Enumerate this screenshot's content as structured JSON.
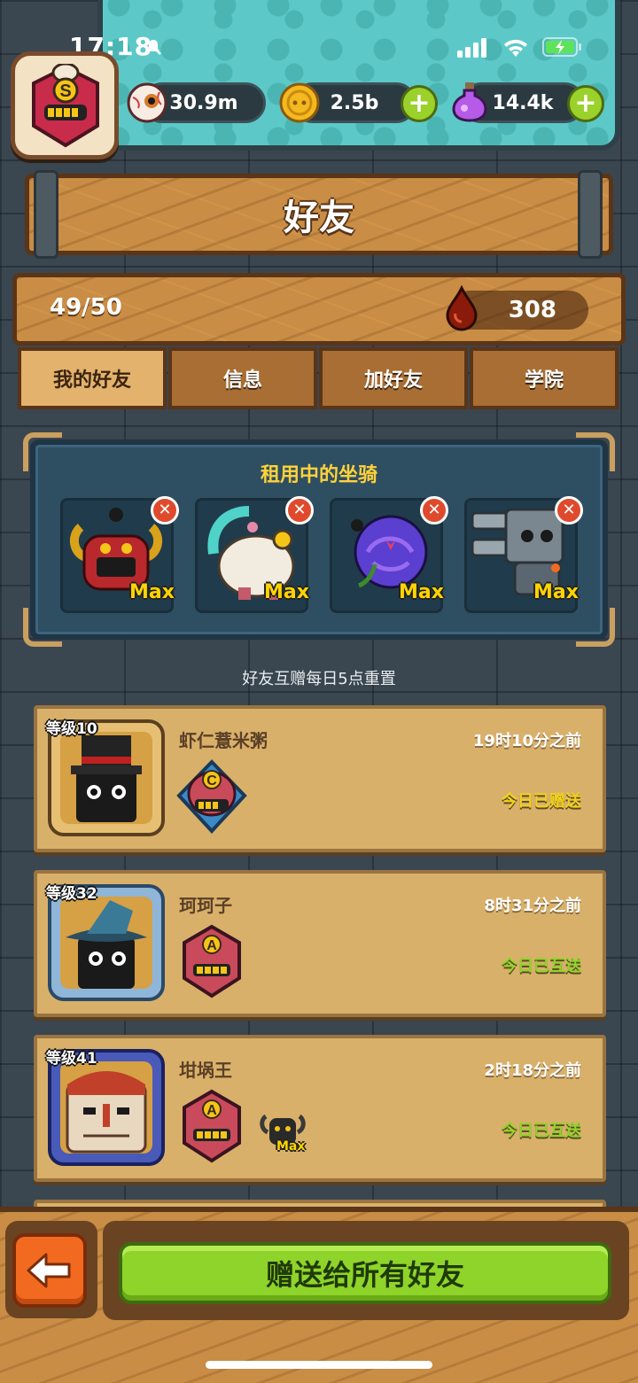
{
  "status_bar": {
    "time": "17:18"
  },
  "header": {
    "rank_letter": "S",
    "resources": {
      "eyes": "30.9m",
      "coins": "2.5b",
      "potions": "14.4k"
    }
  },
  "title": "好友",
  "friend_count": "49/50",
  "blood": "308",
  "tabs": [
    {
      "label": "我的好友",
      "active": true
    },
    {
      "label": "信息"
    },
    {
      "label": "加好友"
    },
    {
      "label": "学院"
    }
  ],
  "mounts": {
    "title": "租用中的坐骑",
    "max_label": "Max",
    "items": [
      {
        "name": "red-demon-mount"
      },
      {
        "name": "white-beast-mount"
      },
      {
        "name": "purple-rose-mount"
      },
      {
        "name": "machine-mount"
      }
    ]
  },
  "reset_note": "好友互赠每日5点重置",
  "friends": [
    {
      "level": "等级10",
      "name": "虾仁薏米粥",
      "time": "19时10分之前",
      "status": "今日已赠送",
      "rank": "C"
    },
    {
      "level": "等级32",
      "name": "珂珂子",
      "time": "8时31分之前",
      "status": "今日已互送",
      "rank": "A"
    },
    {
      "level": "等级41",
      "name": "坩埚王",
      "time": "2时18分之前",
      "status": "今日已互送",
      "rank": "A",
      "mount_max": "Max"
    }
  ],
  "send_all_label": "赠送给所有好友",
  "colors": {
    "accent_yellow": "#ffd23a",
    "status_yellow": "#f2d21c",
    "status_green": "#8fd42a"
  }
}
